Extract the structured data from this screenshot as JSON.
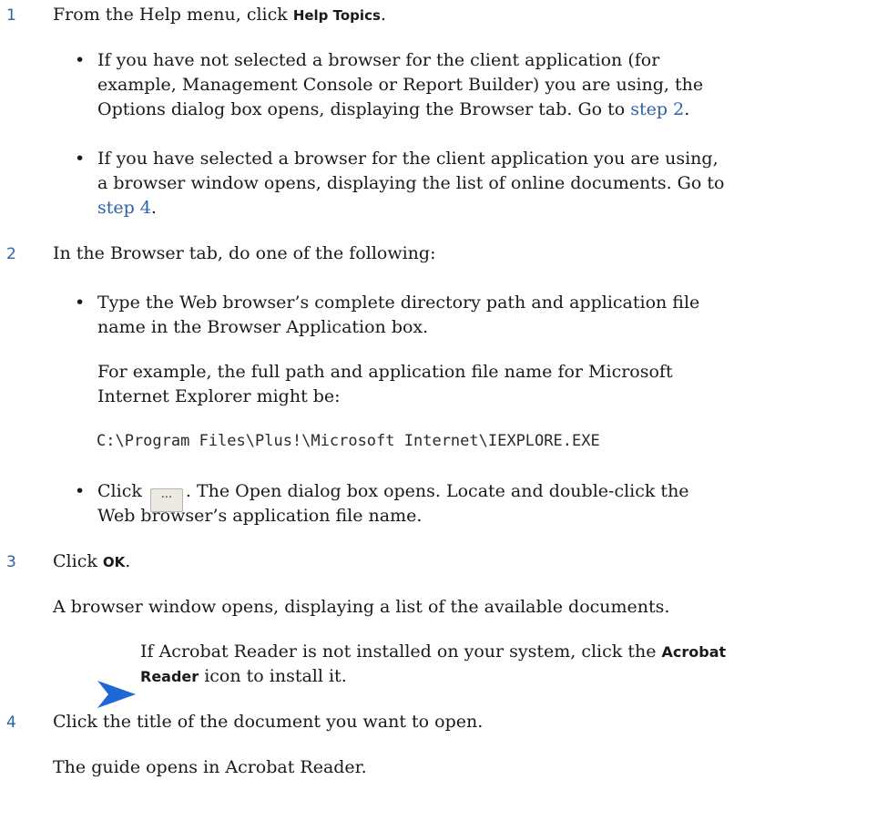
{
  "steps": [
    {
      "number": "1",
      "text_before": "From the Help menu, click ",
      "ui": "Help Topics",
      "text_after": "."
    },
    {
      "number": "2",
      "text": "In the Browser tab, do one of the following:"
    },
    {
      "number": "3",
      "text_before": "Click ",
      "ui": "OK",
      "text_after": "."
    },
    {
      "number": "4",
      "text": "Click the title of the document you want to open."
    }
  ],
  "bullets_step1": {
    "b1_l1": "If you have not selected a browser for the client application (for",
    "b1_l2": "example, Management Console or Report Builder) you are using, the",
    "b1_l3_before": "Options dialog box opens, displaying the Browser tab. Go to ",
    "b1_link": "step 2",
    "b1_l3_after": ".",
    "b2_l1": "If you have selected a browser for the client application you are using,",
    "b2_l2": "a browser window opens, displaying the list of online documents. Go to",
    "b2_link": "step 4",
    "b2_l3_after": "."
  },
  "bullets_step2": {
    "b1_l1": "Type the Web browser’s complete directory path and application file",
    "b1_l2": "name in the Browser Application box.",
    "p_l1": "For example, the full path and application file name for Microsoft",
    "p_l2": "Internet Explorer might be:",
    "code": "C:\\Program Files\\Plus!\\Microsoft Internet\\IEXPLORE.EXE",
    "b2_before": "Click",
    "browse_button": "···",
    "b2_after": ". The Open dialog box opens. Locate and double-click the",
    "b2_l2": "Web browser’s application file name."
  },
  "step3_result": "A browser window opens, displaying a list of the available documents.",
  "note": {
    "l1_before": "If Acrobat Reader is not installed on your system, click the ",
    "l1_ui": "Acrobat",
    "l2_ui": "Reader",
    "l2_after": " icon to install it."
  },
  "step4_result": "The guide opens in Acrobat Reader.",
  "colors": {
    "accent": "#2c62a8",
    "note_arrow": "#1f66d6"
  },
  "bullet_char": "•",
  "note_icon": "right-arrow-icon"
}
